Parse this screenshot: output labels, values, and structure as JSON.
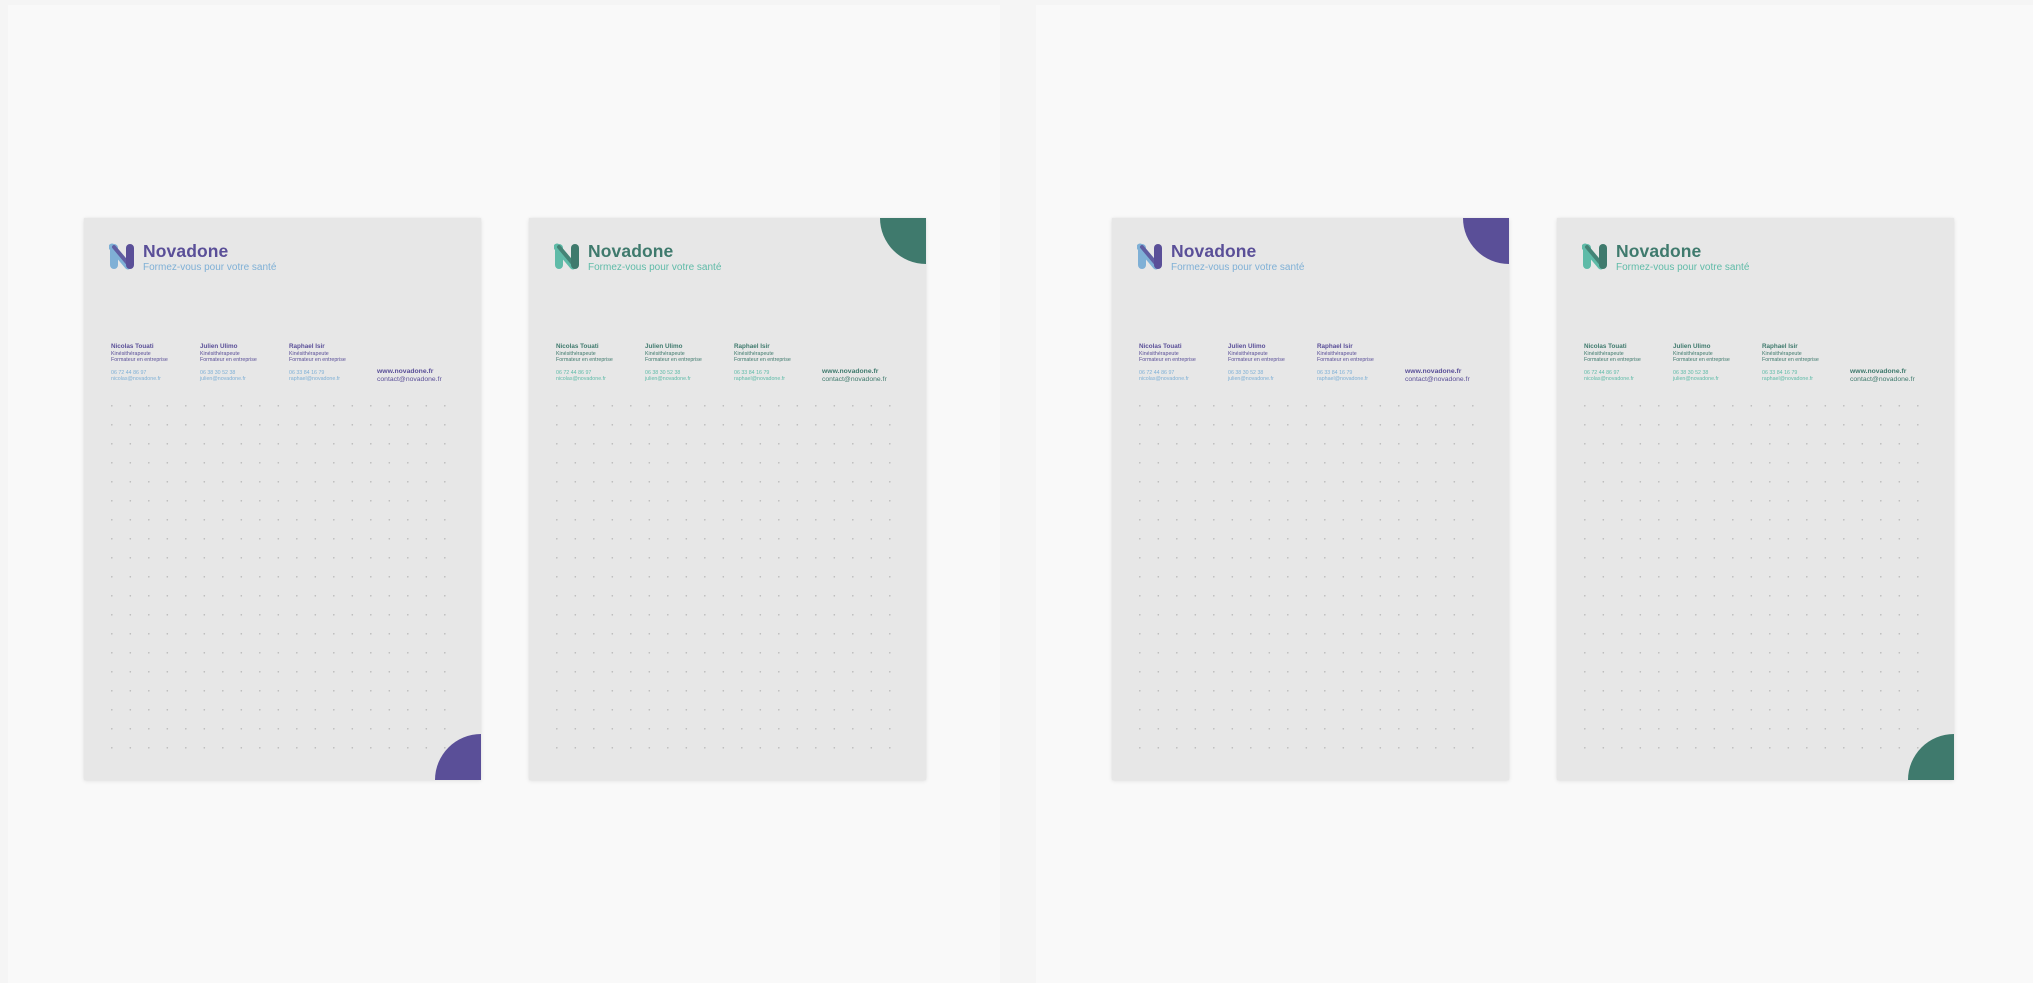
{
  "colors": {
    "purple": "#5a4f98",
    "purple_light": "#7fb0d6",
    "green": "#3f7a6d",
    "green_light": "#5fbba8",
    "dot": "#b8b8b8"
  },
  "panels": [
    {
      "sheets": [
        {
          "theme": "purple",
          "corner": "bottom-right",
          "brand": "Novadone",
          "tagline": "Formez-vous pour votre santé",
          "contacts": [
            {
              "name": "Nicolas Touati",
              "role1": "Kinésithérapeute",
              "role2": "Formateur en entreprise",
              "phone": "06 72 44 86 97",
              "email": "nicolas@novadone.fr"
            },
            {
              "name": "Julien Ulimo",
              "role1": "Kinésithérapeute",
              "role2": "Formateur en entreprise",
              "phone": "06 38 30 52 38",
              "email": "julien@novadone.fr"
            },
            {
              "name": "Raphael Isir",
              "role1": "Kinésithérapeute",
              "role2": "Formateur en entreprise",
              "phone": "06 33 84 16 79",
              "email": "raphael@novadone.fr"
            }
          ],
          "website": "www.novadone.fr",
          "contact_email": "contact@novadone.fr"
        },
        {
          "theme": "green",
          "corner": "top-right",
          "brand": "Novadone",
          "tagline": "Formez-vous pour votre santé",
          "contacts": [
            {
              "name": "Nicolas Touati",
              "role1": "Kinésithérapeute",
              "role2": "Formateur en entreprise",
              "phone": "06 72 44 86 97",
              "email": "nicolas@novadone.fr"
            },
            {
              "name": "Julien Ulimo",
              "role1": "Kinésithérapeute",
              "role2": "Formateur en entreprise",
              "phone": "06 38 30 52 38",
              "email": "julien@novadone.fr"
            },
            {
              "name": "Raphael Isir",
              "role1": "Kinésithérapeute",
              "role2": "Formateur en entreprise",
              "phone": "06 33 84 16 79",
              "email": "raphael@novadone.fr"
            }
          ],
          "website": "www.novadone.fr",
          "contact_email": "contact@novadone.fr"
        }
      ]
    },
    {
      "sheets": [
        {
          "theme": "purple",
          "corner": "top-right",
          "brand": "Novadone",
          "tagline": "Formez-vous pour votre santé",
          "contacts": [
            {
              "name": "Nicolas Touati",
              "role1": "Kinésithérapeute",
              "role2": "Formateur en entreprise",
              "phone": "06 72 44 86 97",
              "email": "nicolas@novadone.fr"
            },
            {
              "name": "Julien Ulimo",
              "role1": "Kinésithérapeute",
              "role2": "Formateur en entreprise",
              "phone": "06 38 30 52 38",
              "email": "julien@novadone.fr"
            },
            {
              "name": "Raphael Isir",
              "role1": "Kinésithérapeute",
              "role2": "Formateur en entreprise",
              "phone": "06 33 84 16 79",
              "email": "raphael@novadone.fr"
            }
          ],
          "website": "www.novadone.fr",
          "contact_email": "contact@novadone.fr"
        },
        {
          "theme": "green",
          "corner": "bottom-right",
          "brand": "Novadone",
          "tagline": "Formez-vous pour votre santé",
          "contacts": [
            {
              "name": "Nicolas Touati",
              "role1": "Kinésithérapeute",
              "role2": "Formateur en entreprise",
              "phone": "06 72 44 86 97",
              "email": "nicolas@novadone.fr"
            },
            {
              "name": "Julien Ulimo",
              "role1": "Kinésithérapeute",
              "role2": "Formateur en entreprise",
              "phone": "06 38 30 52 38",
              "email": "julien@novadone.fr"
            },
            {
              "name": "Raphael Isir",
              "role1": "Kinésithérapeute",
              "role2": "Formateur en entreprise",
              "phone": "06 33 84 16 79",
              "email": "raphael@novadone.fr"
            }
          ],
          "website": "www.novadone.fr",
          "contact_email": "contact@novadone.fr"
        }
      ]
    }
  ]
}
